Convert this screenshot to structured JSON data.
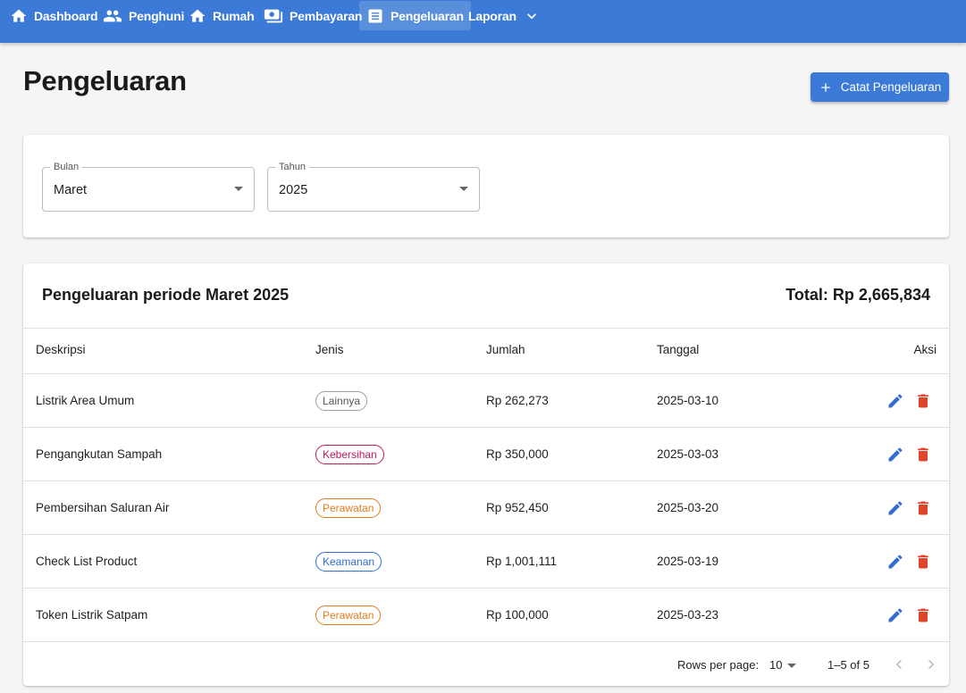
{
  "nav": {
    "items": [
      {
        "label": "Dashboard",
        "icon": "home-icon"
      },
      {
        "label": "Penghuni",
        "icon": "people-icon"
      },
      {
        "label": "Rumah",
        "icon": "home-icon"
      },
      {
        "label": "Pembayaran",
        "icon": "payments-icon"
      },
      {
        "label": "Pengeluaran",
        "icon": "receipt-icon",
        "active": true
      },
      {
        "label": "Laporan",
        "icon": "chevron-down-icon"
      }
    ]
  },
  "page": {
    "title": "Pengeluaran",
    "add_button": "Catat Pengeluaran"
  },
  "filters": {
    "month": {
      "label": "Bulan",
      "value": "Maret"
    },
    "year": {
      "label": "Tahun",
      "value": "2025"
    }
  },
  "summary": {
    "title": "Pengeluaran periode Maret 2025",
    "total": "Total: Rp 2,665,834"
  },
  "table": {
    "headers": [
      "Deskripsi",
      "Jenis",
      "Jumlah",
      "Tanggal",
      "Aksi"
    ],
    "rows": [
      {
        "deskripsi": "Listrik Area Umum",
        "jenis": "Lainnya",
        "jumlah": "Rp 262,273",
        "tanggal": "2025-03-10"
      },
      {
        "deskripsi": "Pengangkutan Sampah",
        "jenis": "Kebersihan",
        "jumlah": "Rp 350,000",
        "tanggal": "2025-03-03"
      },
      {
        "deskripsi": "Pembersihan Saluran Air",
        "jenis": "Perawatan",
        "jumlah": "Rp 952,450",
        "tanggal": "2025-03-20"
      },
      {
        "deskripsi": "Check List Product",
        "jenis": "Keamanan",
        "jumlah": "Rp 1,001,111",
        "tanggal": "2025-03-19"
      },
      {
        "deskripsi": "Token Listrik Satpam",
        "jenis": "Perawatan",
        "jumlah": "Rp 100,000",
        "tanggal": "2025-03-23"
      }
    ]
  },
  "pagination": {
    "rows_per_page_label": "Rows per page:",
    "rows_per_page": "10",
    "range": "1–5 of 5"
  },
  "colors": {
    "primary": "#3b7ad6",
    "edit": "#2f6fd1",
    "delete": "#e0442b",
    "chip_lainnya": "#555555",
    "chip_kebersihan": "#c2185b",
    "chip_perawatan": "#e07b1f",
    "chip_keamanan": "#2f6fd1"
  }
}
